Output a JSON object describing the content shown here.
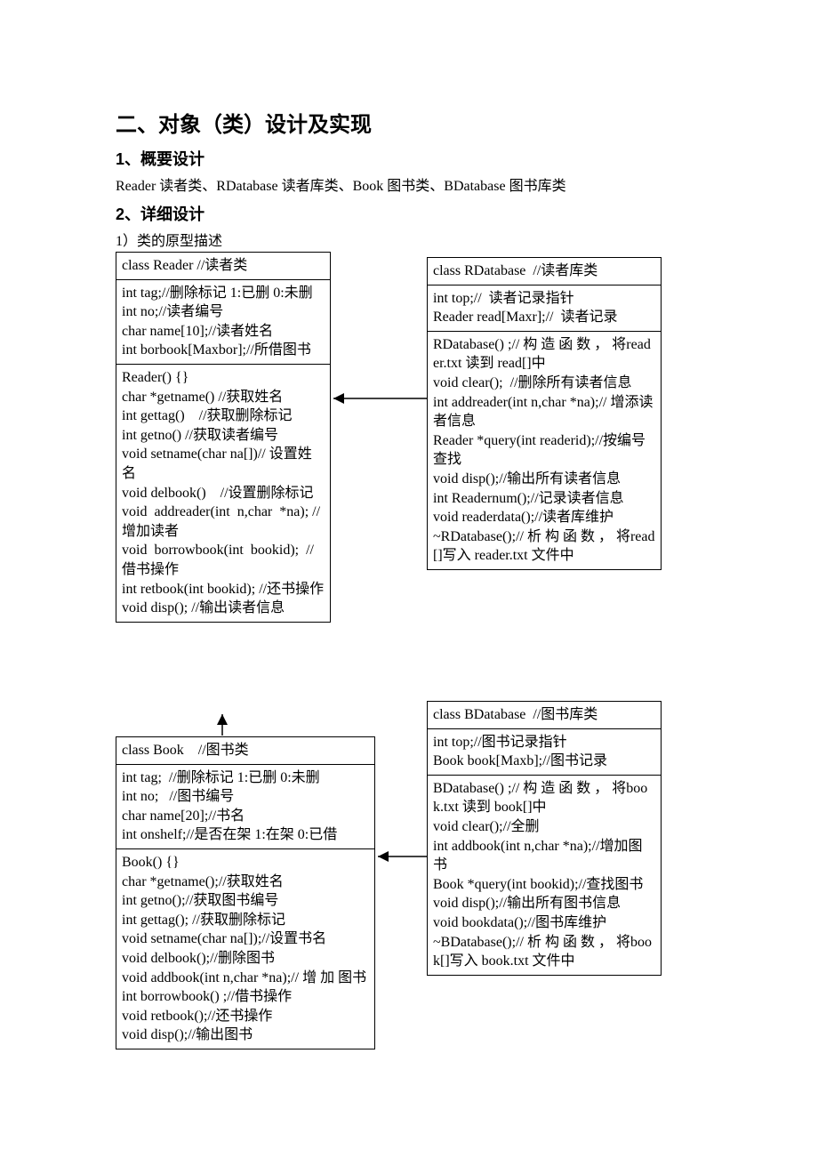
{
  "title": "二、对象（类）设计及实现",
  "section1": {
    "heading": "1、概要设计",
    "text": "Reader 读者类、RDatabase  读者库类、Book  图书类、BDatabase  图书库类"
  },
  "section2": {
    "heading": "2、详细设计",
    "caption": "1）类的原型描述"
  },
  "reader": {
    "title": "class Reader //读者类",
    "attrs": [
      "int tag;//删除标记 1:已删 0:未删",
      "int no;//读者编号",
      "char name[10];//读者姓名",
      "int borbook[Maxbor];//所借图书"
    ],
    "ops": [
      "Reader() {}",
      "char *getname() //获取姓名",
      "int gettag()    //获取删除标记",
      "int getno() //获取读者编号",
      "void setname(char na[])// 设置姓名",
      "void delbook()    //设置删除标记",
      "void  addreader(int  n,char  *na); //增加读者",
      "void  borrowbook(int  bookid);  //借书操作",
      "int retbook(int bookid); //还书操作",
      "void disp(); //输出读者信息"
    ]
  },
  "rdatabase": {
    "title": "class RDatabase  //读者库类",
    "attrs": [
      "int top;//  读者记录指针",
      "Reader read[Maxr];//  读者记录"
    ],
    "ops": [
      "RDatabase() ;// 构 造 函 数 ， 将reader.txt 读到 read[]中",
      "void clear();  //删除所有读者信息",
      "int addreader(int n,char *na);// 增添读者信息",
      "Reader *query(int readerid);//按编号查找",
      "void disp();//输出所有读者信息",
      "int Readernum();//记录读者信息",
      "void readerdata();//读者库维护",
      "~RDatabase();// 析 构 函 数 ， 将read[]写入 reader.txt 文件中"
    ]
  },
  "book": {
    "title": "class Book    //图书类",
    "attrs": [
      "int tag;  //删除标记 1:已删 0:未删",
      "int no;   //图书编号",
      "char name[20];//书名",
      "int onshelf;//是否在架 1:在架 0:已借"
    ],
    "ops": [
      "Book() {}",
      "char *getname();//获取姓名",
      "int getno();//获取图书编号",
      "int gettag(); //获取删除标记",
      "void setname(char na[]);//设置书名",
      "void delbook();//删除图书",
      "void addbook(int n,char *na);// 增 加 图书",
      "int borrowbook() ;//借书操作",
      "void retbook();//还书操作",
      "void disp();//输出图书"
    ]
  },
  "bdatabase": {
    "title": "class BDatabase  //图书库类",
    "attrs": [
      "int top;//图书记录指针",
      "Book book[Maxb];//图书记录"
    ],
    "ops": [
      "BDatabase() ;// 构 造 函 数 ， 将book.txt 读到 book[]中",
      "void clear();//全删",
      "int addbook(int n,char *na);//增加图书",
      "Book *query(int bookid);//查找图书",
      "void disp();//输出所有图书信息",
      "void bookdata();//图书库维护",
      "~BDatabase();// 析 构 函 数 ， 将book[]写入 book.txt 文件中"
    ]
  }
}
